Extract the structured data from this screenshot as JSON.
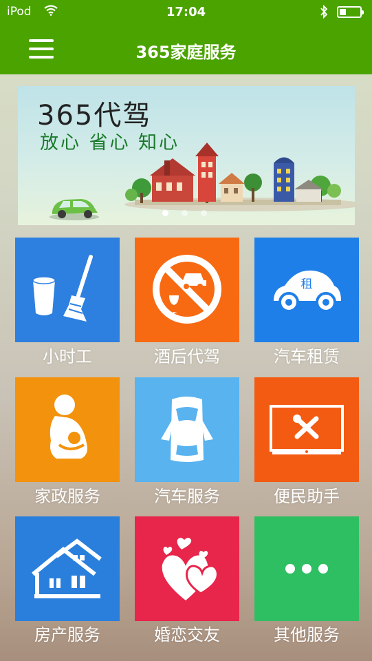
{
  "status_bar": {
    "device": "iPod",
    "time": "17:04"
  },
  "header": {
    "title": "365家庭服务"
  },
  "banner": {
    "headline": "365代驾",
    "slogan": "放心 省心 知心"
  },
  "tiles": [
    {
      "label": "小时工",
      "color": "#2d7fe0",
      "icon": "broom-bucket-icon"
    },
    {
      "label": "酒后代驾",
      "color": "#f76a12",
      "icon": "no-drunk-driving-icon"
    },
    {
      "label": "汽车租赁",
      "color": "#1f7fe8",
      "icon": "rental-car-icon",
      "icon_text": "租"
    },
    {
      "label": "家政服务",
      "color": "#f3920c",
      "icon": "mother-baby-icon"
    },
    {
      "label": "汽车服务",
      "color": "#58b3ef",
      "icon": "car-top-view-icon"
    },
    {
      "label": "便民助手",
      "color": "#f35b12",
      "icon": "monitor-tools-icon"
    },
    {
      "label": "房产服务",
      "color": "#2a7fdc",
      "icon": "houses-icon"
    },
    {
      "label": "婚恋交友",
      "color": "#e8254a",
      "icon": "hearts-icon"
    },
    {
      "label": "其他服务",
      "color": "#2fbf63",
      "icon": "more-dots-icon"
    }
  ]
}
